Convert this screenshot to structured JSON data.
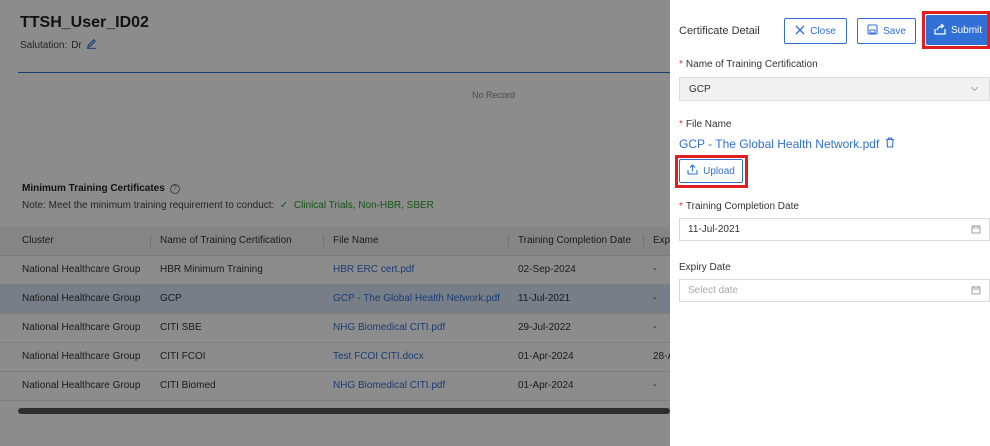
{
  "user": {
    "title": "TTSH_User_ID02",
    "salutation_label": "Salutation:",
    "salutation_value": "Dr"
  },
  "records": {
    "empty_text": "No Record"
  },
  "min_training": {
    "title": "Minimum Training Certificates",
    "note_prefix": "Note: Meet the minimum training requirement to conduct:",
    "note_items": "Clinical Trials, Non-HBR, SBER"
  },
  "table": {
    "headers": [
      "Cluster",
      "Name of Training Certification",
      "File Name",
      "Training Completion Date",
      "Expi"
    ],
    "rows": [
      [
        "National Healthcare Group",
        "HBR Minimum Training",
        "HBR ERC cert.pdf",
        "02-Sep-2024",
        "-"
      ],
      [
        "National Healthcare Group",
        "GCP",
        "GCP - The Global Health Network.pdf",
        "11-Jul-2021",
        "-"
      ],
      [
        "National Healthcare Group",
        "CITI SBE",
        "NHG Biomedical CITI.pdf",
        "29-Jul-2022",
        "-"
      ],
      [
        "National Healthcare Group",
        "CITI FCOI",
        "Test FCOI CITI.docx",
        "01-Apr-2024",
        "28-A"
      ],
      [
        "National Healthcare Group",
        "CITI Biomed",
        "NHG Biomedical CITI.pdf",
        "01-Apr-2024",
        "-"
      ]
    ],
    "selected_row": 1
  },
  "drawer": {
    "title": "Certificate Detail",
    "close_label": "Close",
    "save_label": "Save",
    "submit_label": "Submit",
    "cert_name_label": "Name of Training Certification",
    "cert_name_value": "GCP",
    "file_name_label": "File Name",
    "file_name_value": "GCP - The Global Health Network.pdf",
    "upload_label": "Upload",
    "completion_label": "Training Completion Date",
    "completion_value": "11-Jul-2021",
    "expiry_label": "Expiry Date",
    "expiry_placeholder": "Select date",
    "required_mark": "*"
  },
  "colors": {
    "primary": "#2f6fd6",
    "highlight": "#e02020",
    "selected_row": "#dbe6f7",
    "success": "#2a9a2a"
  }
}
